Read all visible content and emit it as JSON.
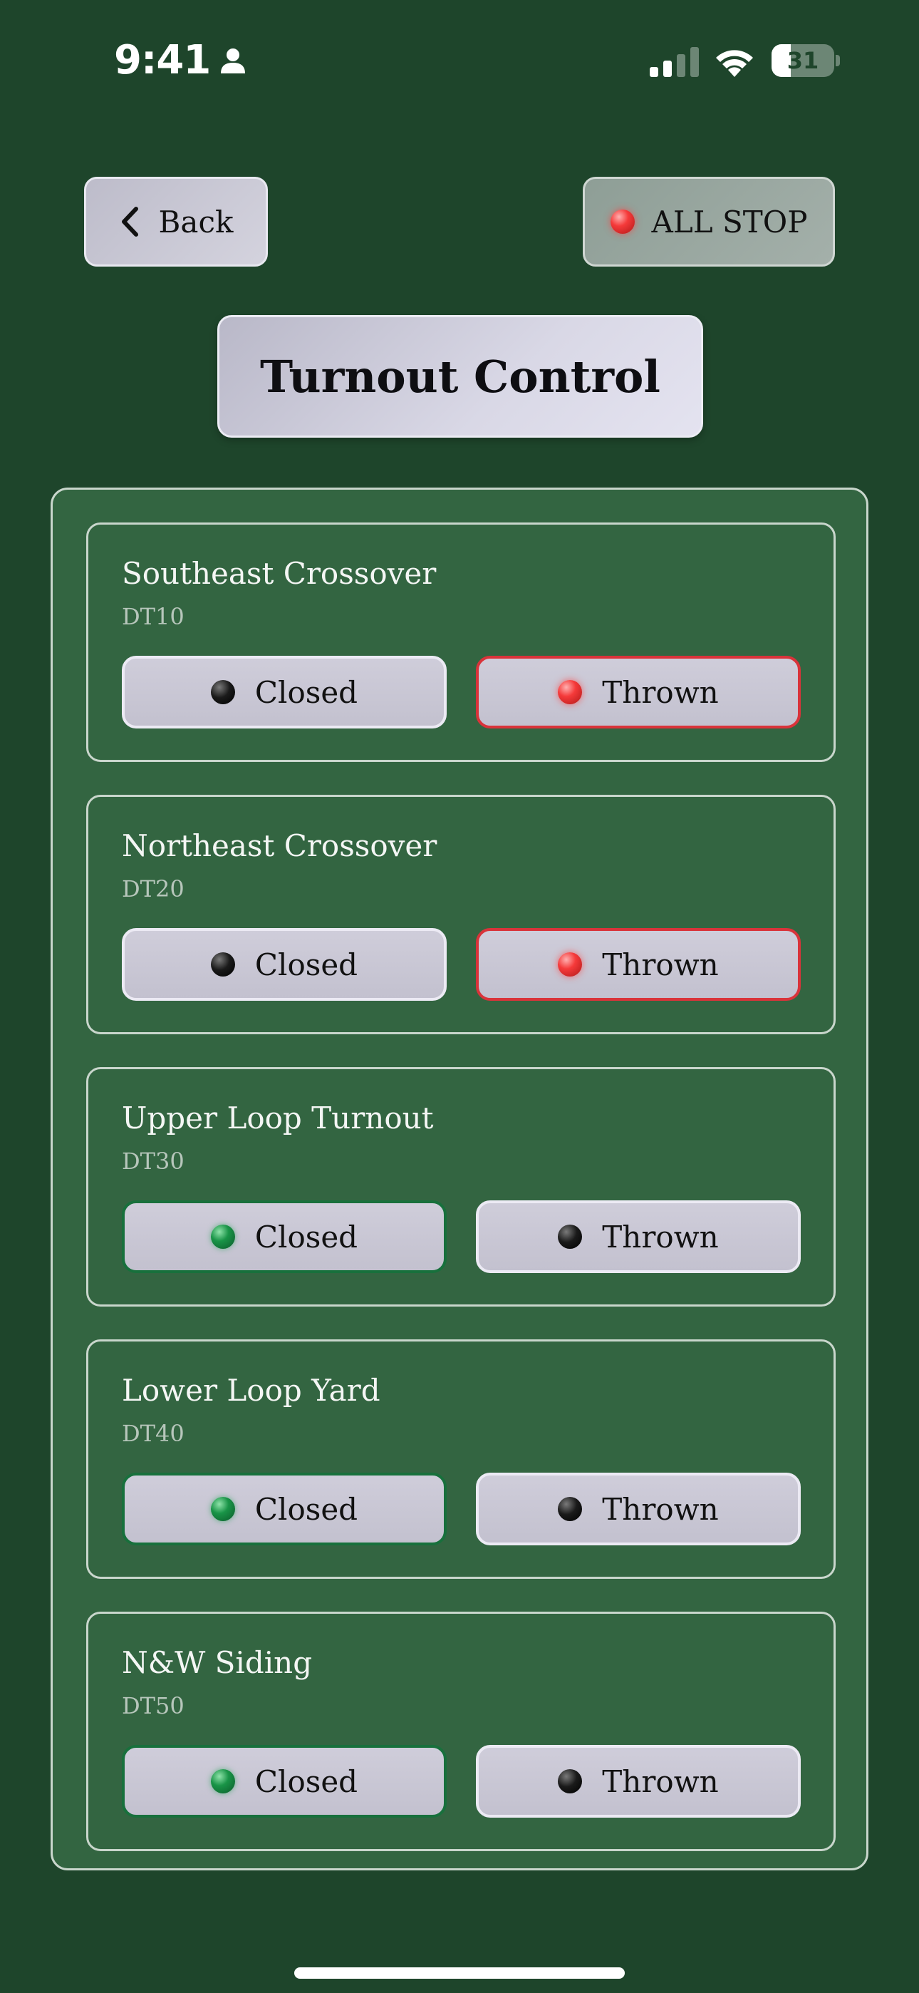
{
  "status_bar": {
    "time": "9:41",
    "battery_level": "31",
    "battery_fraction": 0.31,
    "icons": [
      "person-icon",
      "cellular-signal-icon",
      "wifi-icon",
      "battery-icon"
    ]
  },
  "header": {
    "back_label": "Back",
    "all_stop_label": "ALL STOP",
    "title": "Turnout Control"
  },
  "turnouts": [
    {
      "name": "Southeast Crossover",
      "id": "DT10",
      "closed_label": "Closed",
      "thrown_label": "Thrown",
      "state": "thrown"
    },
    {
      "name": "Northeast Crossover",
      "id": "DT20",
      "closed_label": "Closed",
      "thrown_label": "Thrown",
      "state": "thrown"
    },
    {
      "name": "Upper Loop Turnout",
      "id": "DT30",
      "closed_label": "Closed",
      "thrown_label": "Thrown",
      "state": "closed"
    },
    {
      "name": "Lower Loop Yard",
      "id": "DT40",
      "closed_label": "Closed",
      "thrown_label": "Thrown",
      "state": "closed"
    },
    {
      "name": "N&W Siding",
      "id": "DT50",
      "closed_label": "Closed",
      "thrown_label": "Thrown",
      "state": "closed"
    }
  ],
  "colors": {
    "background": "#1e452b",
    "panel": "#336541",
    "thrown_active": "#d9333a",
    "closed_active": "#18703c"
  }
}
